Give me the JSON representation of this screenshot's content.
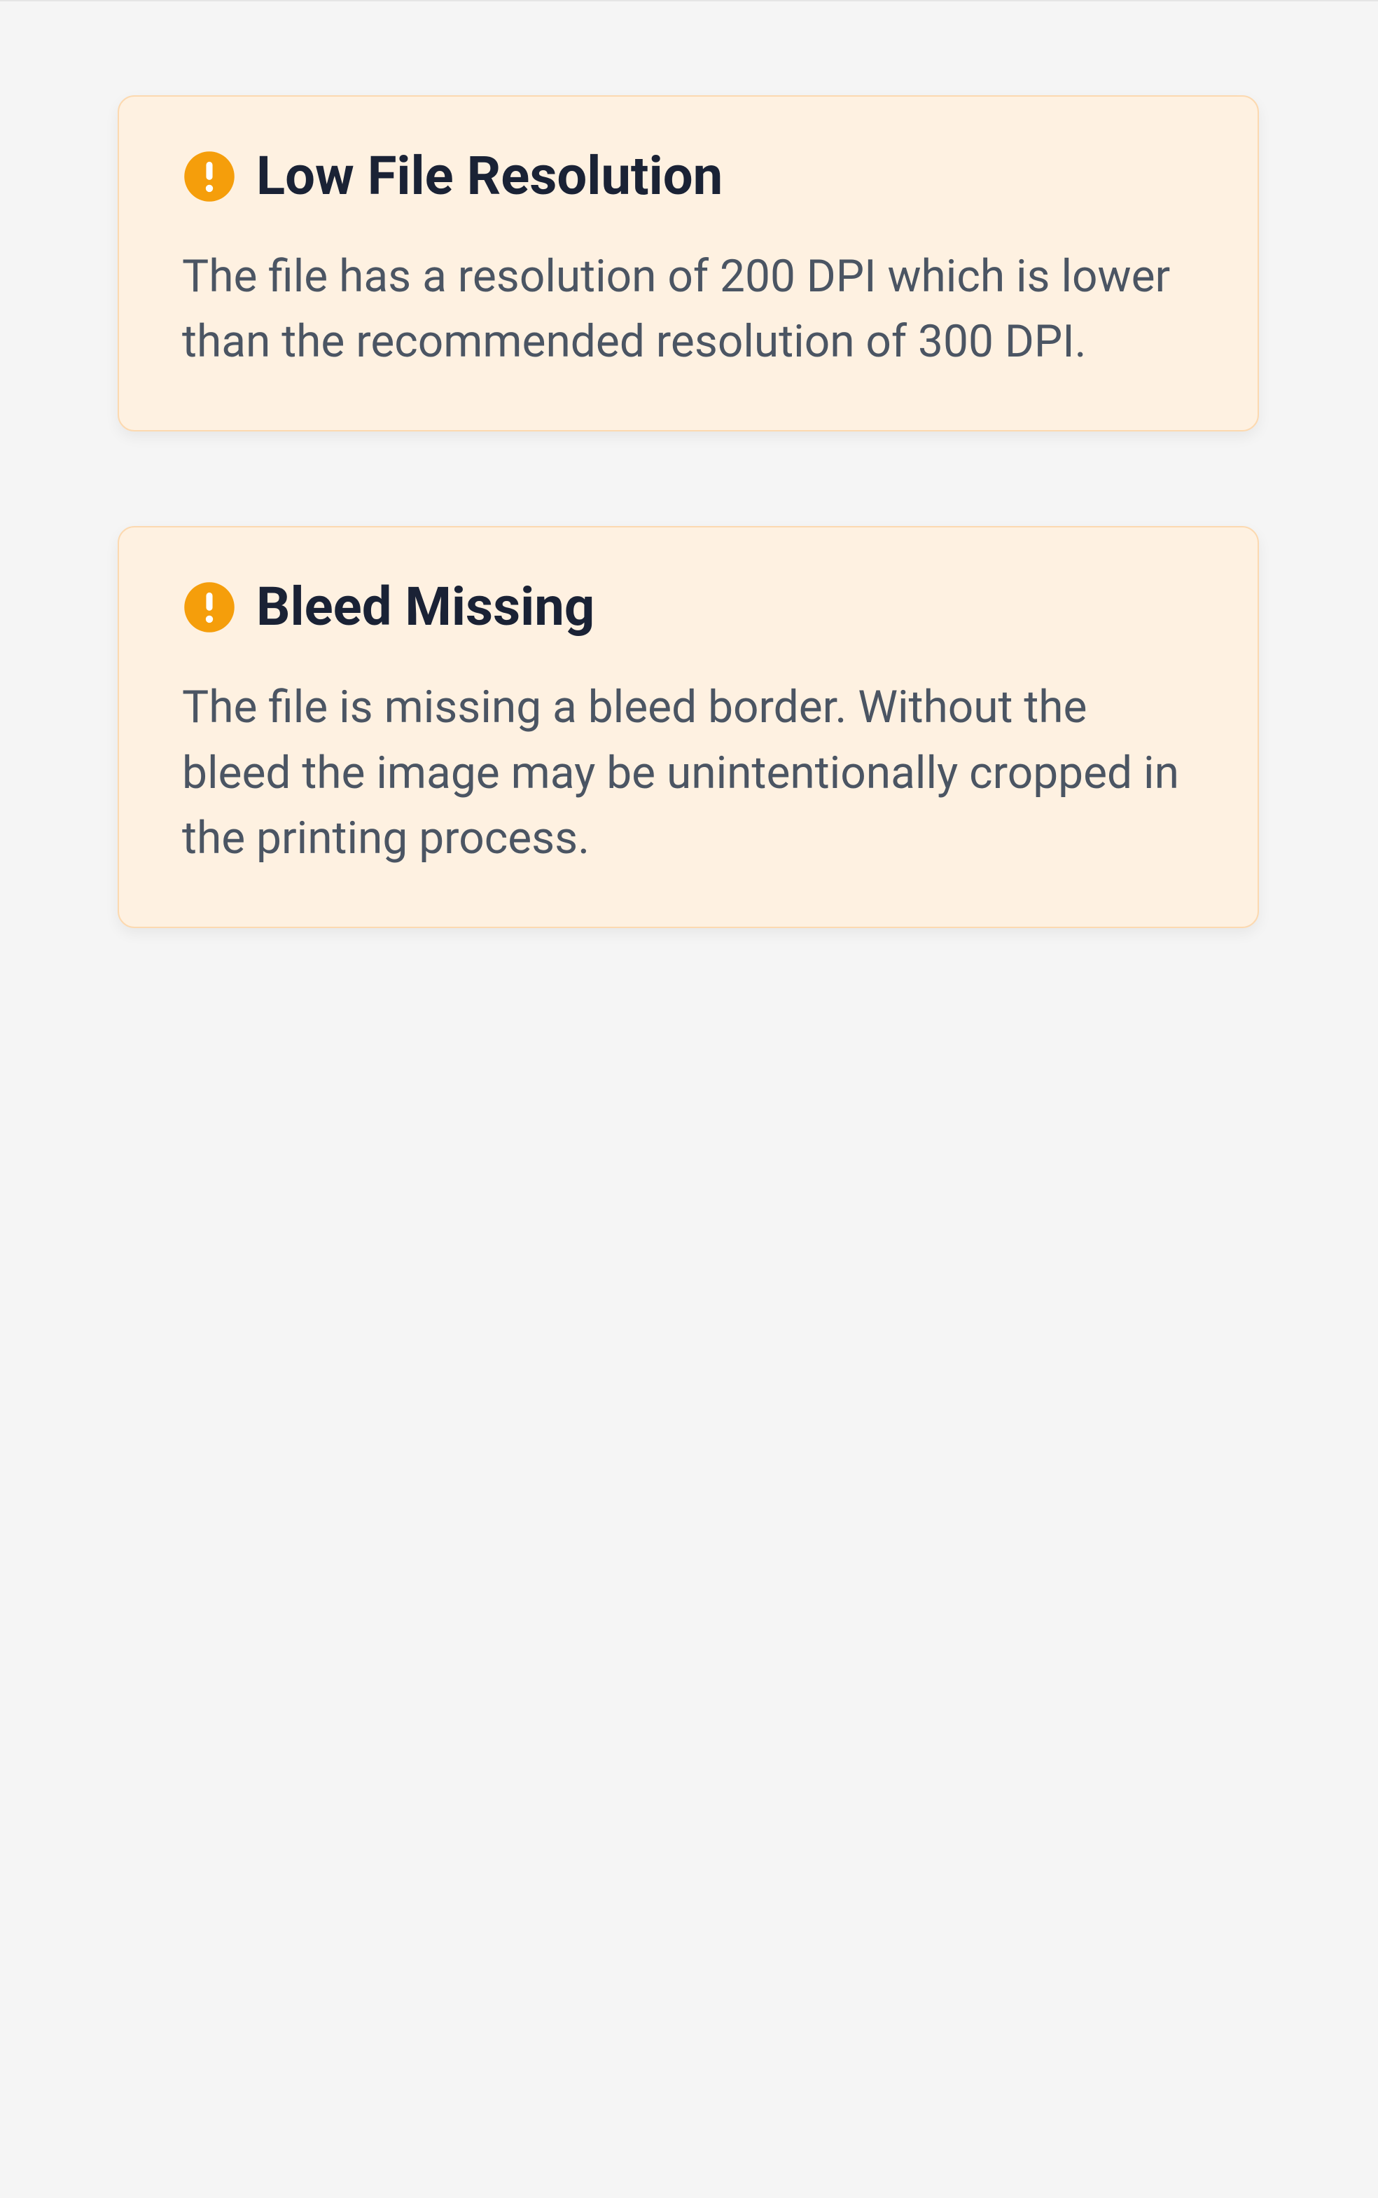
{
  "warnings": [
    {
      "title": "Low File Resolution",
      "description": "The file has a resolution of 200 DPI which is lower than the recommended resolution of 300 DPI."
    },
    {
      "title": "Bleed Missing",
      "description": "The file is missing a bleed border. Without the bleed the image may be unintentionally cropped in the printing process."
    }
  ]
}
